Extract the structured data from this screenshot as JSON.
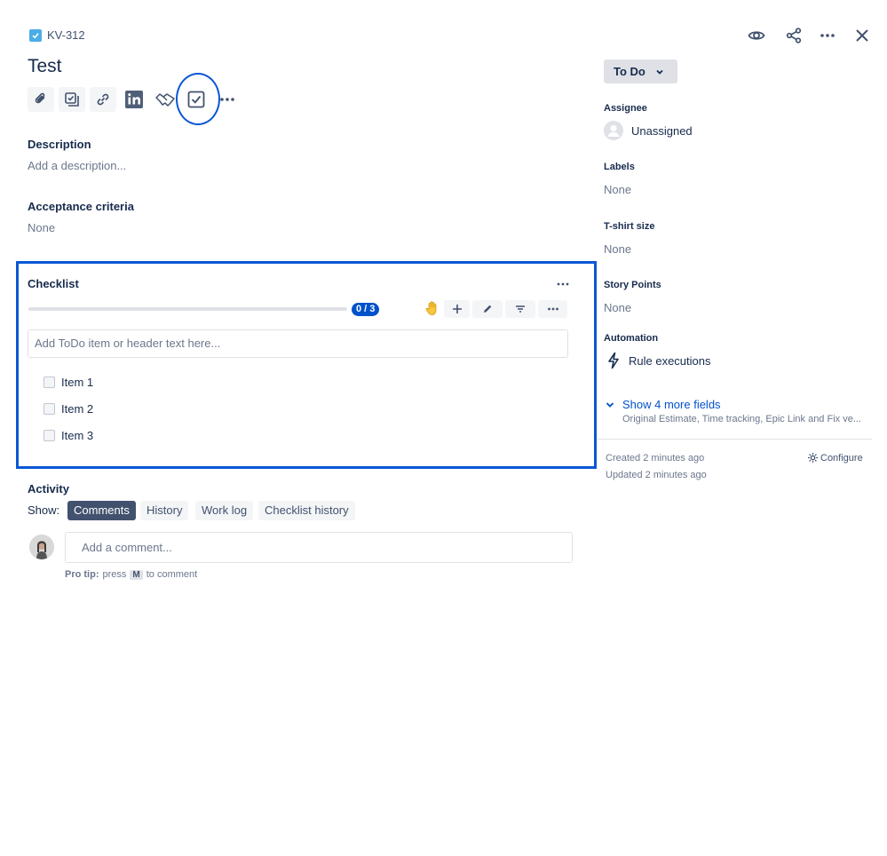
{
  "issue": {
    "key": "KV-312",
    "title": "Test"
  },
  "toolbar": {
    "buttons": [
      "attach-icon",
      "subtask-icon",
      "link-icon",
      "linkedin-icon",
      "hand-shake-icon",
      "checklist-icon",
      "more-icon"
    ],
    "more_label": "•••"
  },
  "header_actions": {
    "watch": "eye-icon",
    "share": "share-icon",
    "more": "more-icon",
    "close": "close-icon"
  },
  "description": {
    "label": "Description",
    "placeholder": "Add a description..."
  },
  "acceptance": {
    "label": "Acceptance criteria",
    "value": "None"
  },
  "checklist": {
    "title": "Checklist",
    "progress_text": "0 / 3",
    "progress_fraction": 0,
    "more_label": "•••",
    "input_placeholder": "Add ToDo item or header text here...",
    "items": [
      {
        "label": "Item 1",
        "checked": false
      },
      {
        "label": "Item 2",
        "checked": false
      },
      {
        "label": "Item 3",
        "checked": false
      }
    ]
  },
  "activity": {
    "label": "Activity",
    "show_label": "Show:",
    "tabs": [
      "Comments",
      "History",
      "Work log",
      "Checklist history"
    ],
    "active_tab": "Comments",
    "comment_placeholder": "Add a comment...",
    "pro_tip_label": "Pro tip:",
    "pro_tip_press": "press",
    "pro_tip_key": "M",
    "pro_tip_rest": "to comment"
  },
  "side": {
    "status": "To Do",
    "assignee_label": "Assignee",
    "assignee_value": "Unassigned",
    "labels_label": "Labels",
    "labels_value": "None",
    "tshirt_label": "T-shirt size",
    "tshirt_value": "None",
    "story_points_label": "Story Points",
    "story_points_value": "None",
    "automation_label": "Automation",
    "automation_value": "Rule executions",
    "show_more": "Show 4 more fields",
    "show_more_sub": "Original Estimate, Time tracking, Epic Link and Fix ve...",
    "created": "Created 2 minutes ago",
    "updated": "Updated 2 minutes ago",
    "configure": "Configure"
  },
  "colors": {
    "accent": "#0052cc",
    "highlight": "#0a57d4",
    "text": "#172b4d",
    "muted": "#6b778c"
  }
}
